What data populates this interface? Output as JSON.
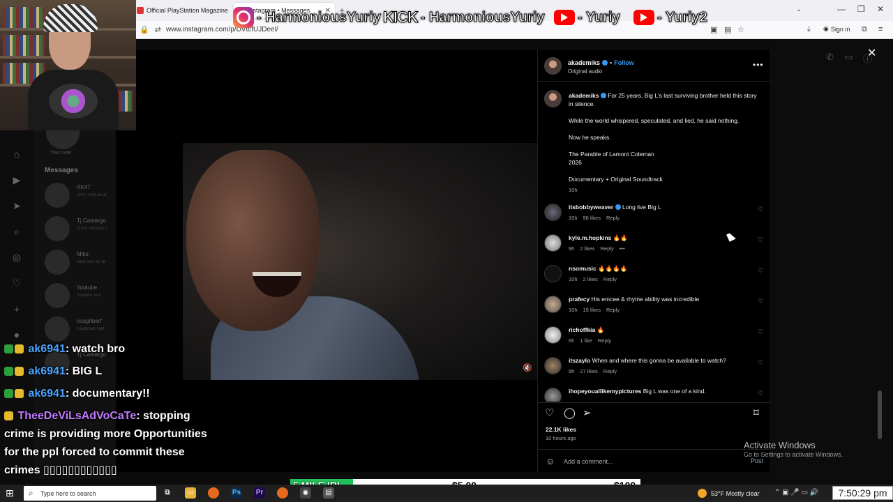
{
  "browser": {
    "tabs": [
      {
        "label": "Official PlayStation Magazine -",
        "active": false
      },
      {
        "label": "Instagram • Messages",
        "active": true
      }
    ],
    "url": "www.instagram.com/p/DVtcfUJDeel/",
    "sign_in": "Sign in"
  },
  "overlay_social": [
    {
      "platform": "instagram-icon",
      "handle": "- HarmoniousYuriy"
    },
    {
      "platform": "kick",
      "logo_text": "KICK",
      "handle": "- HarmoniousYuriy"
    },
    {
      "platform": "youtube-icon",
      "handle": "- Yuriy"
    },
    {
      "platform": "youtube-icon",
      "handle": "- Yuriy2"
    }
  ],
  "ig_sidebar": {
    "your_note": "Your note",
    "messages_heading": "Messages",
    "conversations": [
      {
        "name": "AK47",
        "preview": "AK47 sent an at"
      },
      {
        "name": "Tj Camargo",
        "preview": "Is this Russian d"
      },
      {
        "name": "Mike",
        "preview": "Mike sent an at"
      },
      {
        "name": "Youtube",
        "preview": "Youtube sent"
      },
      {
        "name": "coughbarf",
        "preview": "coughbarf sent"
      },
      {
        "name": "Tj Camargo",
        "preview": ""
      }
    ]
  },
  "post": {
    "author": "akademiks",
    "follow_label": "Follow",
    "audio": "Original audio",
    "caption": {
      "author": "akademiks",
      "line1": "For 25 years, Big L's last surviving brother held this story in silence.",
      "line2": "While the world whispered, speculated, and lied, he said nothing.",
      "line3": "Now he speaks.",
      "line4": "The Parable of Lamont Coleman",
      "line5": "2026",
      "line6": "Documentary + Original Soundtrack",
      "time": "10h"
    },
    "comments": [
      {
        "user": "itsbobbyweaver",
        "text": "Long live Big L",
        "time": "10h",
        "likes": "96 likes",
        "reply": "Reply",
        "verified": true
      },
      {
        "user": "kyle.m.hopkins",
        "text": "🔥🔥",
        "time": "9h",
        "likes": "2 likes",
        "reply": "Reply",
        "extra": "•••"
      },
      {
        "user": "nsomusic",
        "text": "🔥🔥🔥🔥",
        "time": "10h",
        "likes": "2 likes",
        "reply": "Reply"
      },
      {
        "user": "prafecy",
        "text": "His emcee & rhyme ability was incredible",
        "time": "10h",
        "likes": "15 likes",
        "reply": "Reply"
      },
      {
        "user": "richoffkia",
        "text": "🔥",
        "time": "6h",
        "likes": "1 like",
        "reply": "Reply"
      },
      {
        "user": "itszaylo",
        "text": "When and where this gonna be available to watch?",
        "time": "9h",
        "likes": "27 likes",
        "reply": "Reply"
      },
      {
        "user": "ihopeyouallikemypictures",
        "text": "Big L was one of a kind.",
        "time": "",
        "likes": "",
        "reply": ""
      }
    ],
    "likes_count": "22.1K likes",
    "posted_ago": "10 hours ago",
    "add_comment_placeholder": "Add a comment...",
    "post_label": "Post"
  },
  "windows_watermark": {
    "title": "Activate Windows",
    "subtitle": "Go to Settings to activate Windows."
  },
  "chat": [
    {
      "user": "ak6941",
      "message": ": watch bro"
    },
    {
      "user": "ak6941",
      "message": ": BIG L"
    },
    {
      "user": "ak6941",
      "message": ": documentary!!"
    },
    {
      "user": "TheeDeViLsAdVoCaTe",
      "message": ": stopping crime is providing more Opportunities for the ppl forced to commit these crimes ▯▯▯▯▯▯▯▯▯▯▯▯"
    }
  ],
  "donation_goal": {
    "label": "5 MILE IRL",
    "current": "$5.00",
    "goal": "$100",
    "progress": 0.05
  },
  "taskbar": {
    "search_placeholder": "Type here to search",
    "weather": "53°F  Mostly clear",
    "clock": "7:50:29 pm"
  },
  "colors": {
    "ig_blue": "#3897f0",
    "donation_green": "#21c25a",
    "chat_user": "#4aa3ff",
    "chat_user_alt": "#c07cff"
  }
}
